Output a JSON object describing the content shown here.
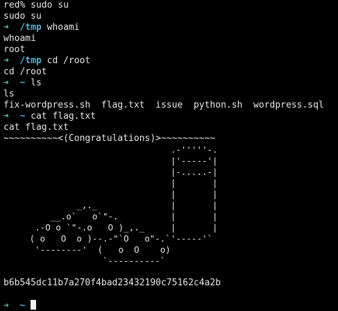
{
  "colors": {
    "background": "#000000",
    "foreground": "#e8e8e8",
    "prompt_arrow": "#4ec9a4",
    "prompt_dir": "#4fb3d9"
  },
  "icons": {
    "prompt_arrow": "arrow-icon",
    "cursor": "block-cursor"
  },
  "terminal": {
    "line1": "red% sudo su",
    "line2": "sudo su",
    "prompt1": {
      "arrow": "➜",
      "dir": "/tmp",
      "command": "whoami"
    },
    "line4": "whoami",
    "line5": "root",
    "prompt2": {
      "arrow": "➜",
      "dir": "/tmp",
      "command": "cd /root"
    },
    "line7": "cd /root",
    "prompt3": {
      "arrow": "➜",
      "dir": "~",
      "command": "ls"
    },
    "line9": "ls",
    "ls_output": "fix-wordpress.sh  flag.txt  issue  python.sh  wordpress.sql",
    "prompt4": {
      "arrow": "➜",
      "dir": "~",
      "command": "cat flag.txt"
    },
    "line12": "cat flag.txt",
    "banner": "~~~~~~~~~~<(Congratulations)>~~~~~~~~~~",
    "art": [
      "                                .-'''''-.",
      "                                |'-----'|",
      "                                |-.....-|",
      "                                |       |",
      "                                |       |",
      "              _,._              |       |",
      "         __.o`   o`\"-.          |       |",
      "      .-O o `\"-.o   O )_,._     |       |",
      "     ( o   O  o )--.-\"`O   o\"-.`'-----'`",
      "      '--------'  (   o  O    o)",
      "                   `----------`"
    ],
    "flag": "b6b545dc11b7a270f4bad23432190c75162c4a2b",
    "prompt5": {
      "arrow": "➜",
      "dir": "~"
    }
  }
}
